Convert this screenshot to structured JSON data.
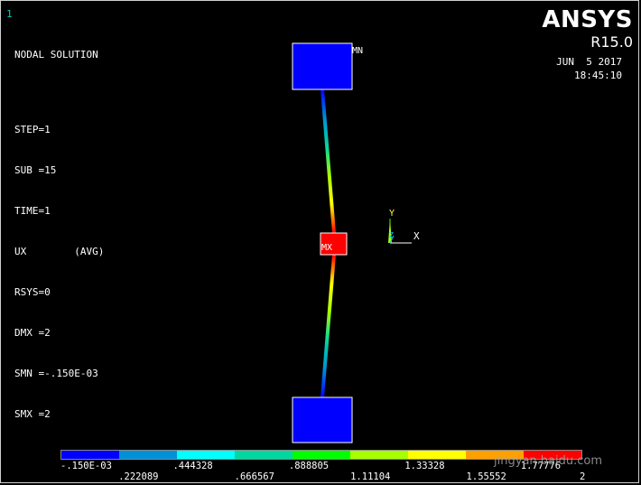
{
  "window_number": "1",
  "info": {
    "line1": "NODAL SOLUTION",
    "line2": "",
    "line3": "STEP=1",
    "line4": "SUB =15",
    "line5": "TIME=1",
    "line6": "UX        (AVG)",
    "line7": "RSYS=0",
    "line8": "DMX =2",
    "line9": "SMN =-.150E-03",
    "line10": "SMX =2"
  },
  "brand": {
    "name": "ANSYS",
    "release": "R15.0"
  },
  "stamp": {
    "date": "JUN  5 2017",
    "time": "18:45:10"
  },
  "markers": {
    "min": "MN",
    "max": "MX"
  },
  "triad": {
    "y": "Y",
    "x": "X",
    "z": "Z"
  },
  "legend": {
    "colors": [
      "#0000ff",
      "#0090d8",
      "#00ffff",
      "#00d8a0",
      "#00ff00",
      "#a8ff00",
      "#ffff00",
      "#ffa000",
      "#ff0000"
    ],
    "labels_top": [
      "-.150E-03",
      ".444328",
      ".888805",
      "1.33328",
      "1.77776"
    ],
    "labels_bottom": [
      ".222089",
      ".666567",
      "1.11104",
      "1.55552",
      "2"
    ]
  },
  "watermark": "jingyan.baidu.com"
}
